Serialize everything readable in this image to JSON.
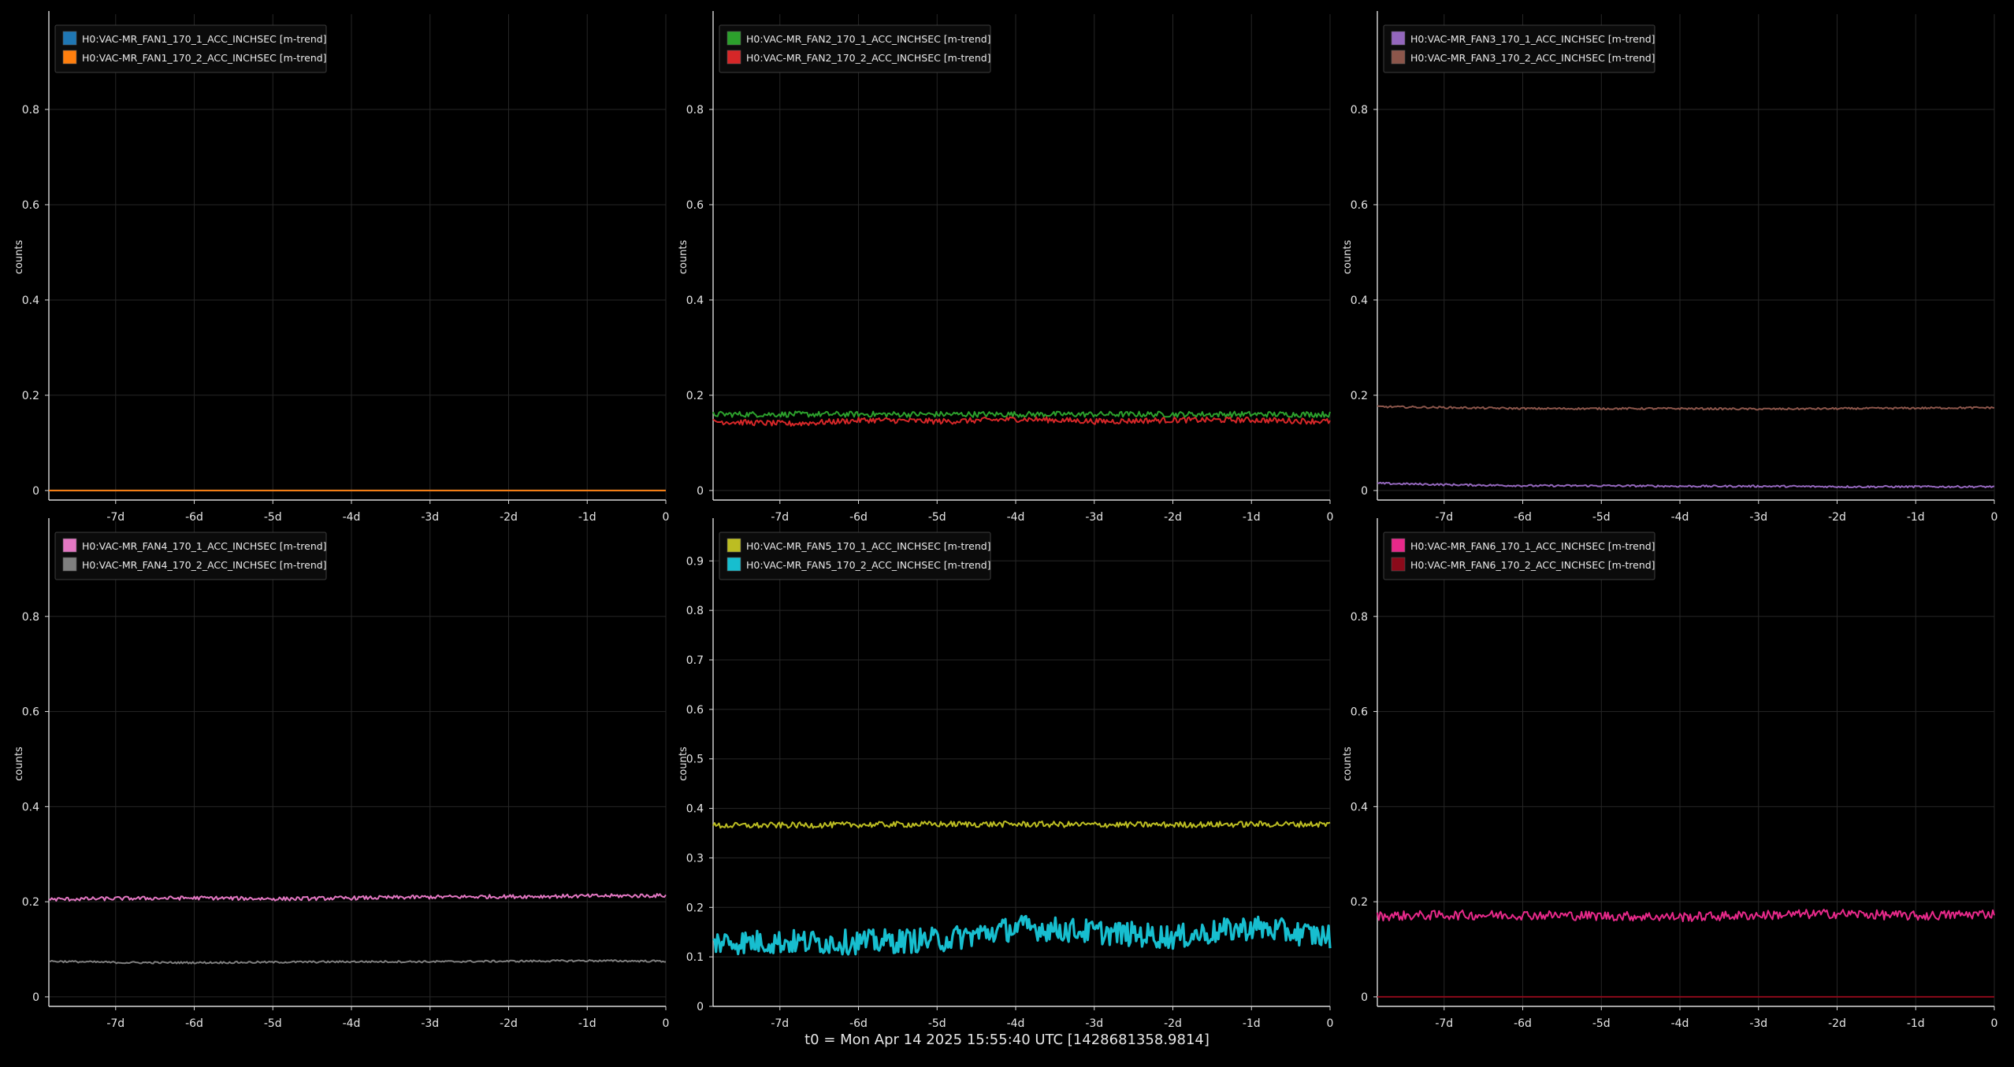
{
  "footer": "t0 = Mon Apr 14 2025 15:55:40 UTC [1428681358.9814]",
  "chart_data": [
    {
      "type": "line",
      "ylabel": "counts",
      "x_ticks": [
        "-7d",
        "-6d",
        "-5d",
        "-4d",
        "-3d",
        "-2d",
        "-1d",
        "0"
      ],
      "xlim": [
        -7.85,
        0
      ],
      "ylim": [
        -0.02,
        1.0
      ],
      "y_ticks": [
        0,
        0.2,
        0.4,
        0.6,
        0.8
      ],
      "y_tick_labels": [
        "0",
        "0.2",
        "0.4",
        "0.6",
        "0.8"
      ],
      "grid": true,
      "legend_position": "top-left",
      "series": [
        {
          "name": "H0:VAC-MR_FAN1_170_1_ACC_INCHSEC [m-trend]",
          "color": "#1f77b4",
          "values": [
            0.0,
            0.0,
            0.0,
            0.0,
            0.0,
            0.0,
            0.0,
            0.0,
            0.0
          ],
          "noise": 0.0
        },
        {
          "name": "H0:VAC-MR_FAN1_170_2_ACC_INCHSEC [m-trend]",
          "color": "#ff7f0e",
          "values": [
            0.0,
            0.0,
            0.0,
            0.0,
            0.0,
            0.0,
            0.0,
            0.0,
            0.0
          ],
          "noise": 0.0
        }
      ]
    },
    {
      "type": "line",
      "ylabel": "counts",
      "x_ticks": [
        "-7d",
        "-6d",
        "-5d",
        "-4d",
        "-3d",
        "-2d",
        "-1d",
        "0"
      ],
      "xlim": [
        -7.85,
        0
      ],
      "ylim": [
        -0.02,
        1.0
      ],
      "y_ticks": [
        0,
        0.2,
        0.4,
        0.6,
        0.8
      ],
      "y_tick_labels": [
        "0",
        "0.2",
        "0.4",
        "0.6",
        "0.8"
      ],
      "grid": true,
      "legend_position": "top-left",
      "series": [
        {
          "name": "H0:VAC-MR_FAN2_170_1_ACC_INCHSEC [m-trend]",
          "color": "#2ca02c",
          "values": [
            0.16,
            0.16,
            0.16,
            0.16,
            0.16,
            0.16,
            0.16,
            0.16,
            0.16
          ],
          "noise": 0.006
        },
        {
          "name": "H0:VAC-MR_FAN2_170_2_ACC_INCHSEC [m-trend]",
          "color": "#d62728",
          "values": [
            0.145,
            0.14,
            0.148,
            0.145,
            0.15,
            0.145,
            0.148,
            0.148,
            0.145
          ],
          "noise": 0.006
        }
      ]
    },
    {
      "type": "line",
      "ylabel": "counts",
      "x_ticks": [
        "-7d",
        "-6d",
        "-5d",
        "-4d",
        "-3d",
        "-2d",
        "-1d",
        "0"
      ],
      "xlim": [
        -7.85,
        0
      ],
      "ylim": [
        -0.02,
        1.0
      ],
      "y_ticks": [
        0,
        0.2,
        0.4,
        0.6,
        0.8
      ],
      "y_tick_labels": [
        "0",
        "0.2",
        "0.4",
        "0.6",
        "0.8"
      ],
      "grid": true,
      "legend_position": "top-left",
      "series": [
        {
          "name": "H0:VAC-MR_FAN3_170_1_ACC_INCHSEC [m-trend]",
          "color": "#9467bd",
          "values": [
            0.015,
            0.012,
            0.01,
            0.01,
            0.009,
            0.009,
            0.008,
            0.008,
            0.008
          ],
          "noise": 0.002
        },
        {
          "name": "H0:VAC-MR_FAN3_170_2_ACC_INCHSEC [m-trend]",
          "color": "#8c564b",
          "values": [
            0.176,
            0.174,
            0.172,
            0.172,
            0.172,
            0.171,
            0.172,
            0.173,
            0.174
          ],
          "noise": 0.002
        }
      ]
    },
    {
      "type": "line",
      "ylabel": "counts",
      "x_ticks": [
        "-7d",
        "-6d",
        "-5d",
        "-4d",
        "-3d",
        "-2d",
        "-1d",
        "0"
      ],
      "xlim": [
        -7.85,
        0
      ],
      "ylim": [
        -0.02,
        1.0
      ],
      "y_ticks": [
        0,
        0.2,
        0.4,
        0.6,
        0.8
      ],
      "y_tick_labels": [
        "0",
        "0.2",
        "0.4",
        "0.6",
        "0.8"
      ],
      "grid": true,
      "legend_position": "top-left",
      "series": [
        {
          "name": "H0:VAC-MR_FAN4_170_1_ACC_INCHSEC [m-trend]",
          "color": "#e377c2",
          "values": [
            0.205,
            0.207,
            0.208,
            0.206,
            0.208,
            0.21,
            0.211,
            0.212,
            0.213
          ],
          "noise": 0.004
        },
        {
          "name": "H0:VAC-MR_FAN4_170_2_ACC_INCHSEC [m-trend]",
          "color": "#7f7f7f",
          "values": [
            0.075,
            0.072,
            0.072,
            0.073,
            0.074,
            0.074,
            0.075,
            0.076,
            0.075
          ],
          "noise": 0.002
        }
      ]
    },
    {
      "type": "line",
      "ylabel": "counts",
      "x_ticks": [
        "-7d",
        "-6d",
        "-5d",
        "-4d",
        "-3d",
        "-2d",
        "-1d",
        "0"
      ],
      "xlim": [
        -7.85,
        0
      ],
      "ylim": [
        0,
        0.98
      ],
      "y_ticks": [
        0,
        0.1,
        0.2,
        0.3,
        0.4,
        0.5,
        0.6,
        0.7,
        0.8,
        0.9
      ],
      "y_tick_labels": [
        "0",
        "0.1",
        "0.2",
        "0.3",
        "0.4",
        "0.5",
        "0.6",
        "0.7",
        "0.8",
        "0.9"
      ],
      "grid": true,
      "legend_position": "top-left",
      "series": [
        {
          "name": "H0:VAC-MR_FAN5_170_1_ACC_INCHSEC [m-trend]",
          "color": "#bcbd22",
          "values": [
            0.365,
            0.366,
            0.367,
            0.368,
            0.368,
            0.367,
            0.367,
            0.368,
            0.368
          ],
          "noise": 0.006
        },
        {
          "name": "H0:VAC-MR_FAN5_170_2_ACC_INCHSEC [m-trend]",
          "color": "#17becf",
          "values": [
            0.13,
            0.13,
            0.13,
            0.135,
            0.16,
            0.15,
            0.14,
            0.16,
            0.14
          ],
          "noise": 0.025
        }
      ]
    },
    {
      "type": "line",
      "ylabel": "counts",
      "x_ticks": [
        "-7d",
        "-6d",
        "-5d",
        "-4d",
        "-3d",
        "-2d",
        "-1d",
        "0"
      ],
      "xlim": [
        -7.85,
        0
      ],
      "ylim": [
        -0.02,
        1.0
      ],
      "y_ticks": [
        0,
        0.2,
        0.4,
        0.6,
        0.8
      ],
      "y_tick_labels": [
        "0",
        "0.2",
        "0.4",
        "0.6",
        "0.8"
      ],
      "grid": true,
      "legend_position": "top-left",
      "series": [
        {
          "name": "H0:VAC-MR_FAN6_170_1_ACC_INCHSEC [m-trend]",
          "color": "#e7298a",
          "values": [
            0.17,
            0.172,
            0.172,
            0.17,
            0.168,
            0.172,
            0.175,
            0.17,
            0.175
          ],
          "noise": 0.01
        },
        {
          "name": "H0:VAC-MR_FAN6_170_2_ACC_INCHSEC [m-trend]",
          "color": "#8b0a1a",
          "values": [
            0.0,
            0.0,
            0.0,
            0.0,
            0.0,
            0.0,
            0.0,
            0.0,
            0.0
          ],
          "noise": 0.0
        }
      ]
    }
  ]
}
